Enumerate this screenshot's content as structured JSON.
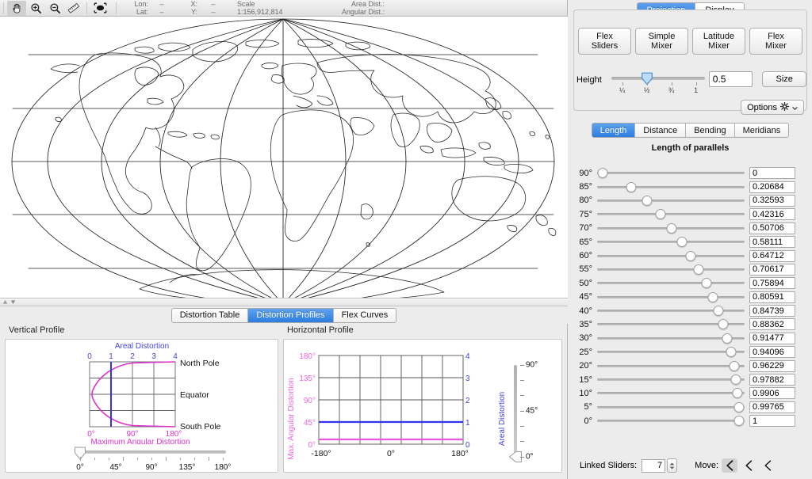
{
  "toolbar": {
    "tools": [
      {
        "name": "pan-tool",
        "icon": "hand-icon",
        "selected": true
      },
      {
        "name": "zoom-in-tool",
        "icon": "magnifier-plus-icon",
        "selected": false
      },
      {
        "name": "zoom-out-tool",
        "icon": "magnifier-minus-icon",
        "selected": false
      },
      {
        "name": "measure-tool",
        "icon": "ruler-icon",
        "selected": false
      },
      {
        "name": "fit-to-window-tool",
        "icon": "fit-bounds-icon",
        "selected": false
      }
    ],
    "status": {
      "lon_label": "Lon:",
      "lon_value": "–",
      "lat_label": "Lat:",
      "lat_value": "–",
      "x_label": "X:",
      "x_value": "–",
      "y_label": "Y:",
      "y_value": "–",
      "scale_label": "Scale",
      "scale_value": "1:156,912,814",
      "area_dist_label": "Area Dist.:",
      "area_dist_value": "",
      "angular_dist_label": "Angular Dist.:",
      "angular_dist_value": ""
    }
  },
  "bottom_tabs": {
    "items": [
      "Distortion Table",
      "Distortion Profiles",
      "Flex Curves"
    ],
    "selected_index": 1
  },
  "vertical_profile": {
    "title": "Vertical Profile",
    "slider": {
      "value_deg": 0,
      "tick_labels": [
        "0°",
        "45°",
        "90°",
        "135°",
        "180°"
      ]
    }
  },
  "horizontal_profile": {
    "title": "Horizontal Profile",
    "slider": {
      "value_deg": 0,
      "tick_labels": [
        "90°",
        "45°",
        "0°"
      ]
    }
  },
  "right_panel": {
    "top_tabs": {
      "items": [
        "Projection",
        "Display"
      ],
      "selected_index": 0
    },
    "mixer_buttons": [
      {
        "line1": "Flex",
        "line2": "Sliders"
      },
      {
        "line1": "Simple",
        "line2": "Mixer"
      },
      {
        "line1": "Latitude",
        "line2": "Mixer"
      },
      {
        "line1": "Flex",
        "line2": "Mixer"
      }
    ],
    "height": {
      "label": "Height",
      "value": "0.5",
      "fraction": 0.5,
      "ticks": [
        {
          "label": "¼",
          "pos": 0.25
        },
        {
          "label": "½",
          "pos": 0.5
        },
        {
          "label": "¾",
          "pos": 0.75
        },
        {
          "label": "1",
          "pos": 1.0
        }
      ]
    },
    "size_button": "Size",
    "options_button": "Options",
    "dist_tabs": {
      "items": [
        "Length",
        "Distance",
        "Bending",
        "Meridians"
      ],
      "selected_index": 0
    },
    "sliders_title": "Length of parallels",
    "parallels": [
      {
        "deg": "90°",
        "value": "0",
        "frac": 0.0
      },
      {
        "deg": "85°",
        "value": "0.20684",
        "frac": 0.20684
      },
      {
        "deg": "80°",
        "value": "0.32593",
        "frac": 0.32593
      },
      {
        "deg": "75°",
        "value": "0.42316",
        "frac": 0.42316
      },
      {
        "deg": "70°",
        "value": "0.50706",
        "frac": 0.50706
      },
      {
        "deg": "65°",
        "value": "0.58111",
        "frac": 0.58111
      },
      {
        "deg": "60°",
        "value": "0.64712",
        "frac": 0.64712
      },
      {
        "deg": "55°",
        "value": "0.70617",
        "frac": 0.70617
      },
      {
        "deg": "50°",
        "value": "0.75894",
        "frac": 0.75894
      },
      {
        "deg": "45°",
        "value": "0.80591",
        "frac": 0.80591
      },
      {
        "deg": "40°",
        "value": "0.84739",
        "frac": 0.84739
      },
      {
        "deg": "35°",
        "value": "0.88362",
        "frac": 0.88362
      },
      {
        "deg": "30°",
        "value": "0.91477",
        "frac": 0.91477
      },
      {
        "deg": "25°",
        "value": "0.94096",
        "frac": 0.94096
      },
      {
        "deg": "20°",
        "value": "0.96229",
        "frac": 0.96229
      },
      {
        "deg": "15°",
        "value": "0.97882",
        "frac": 0.97882
      },
      {
        "deg": "10°",
        "value": "0.9906",
        "frac": 0.9906
      },
      {
        "deg": "5°",
        "value": "0.99765",
        "frac": 0.99765
      },
      {
        "deg": "0°",
        "value": "1",
        "frac": 1.0
      }
    ],
    "bottom": {
      "linked_sliders_label": "Linked Sliders:",
      "linked_sliders_value": "7",
      "move_label": "Move:",
      "move_buttons": [
        "move-left-fast",
        "move-left",
        "move-left-slow"
      ],
      "move_selected_index": 0
    }
  },
  "colors": {
    "accent_blue": "#2b7de0",
    "areal_blue": "#3333ee",
    "angular_magenta": "#dd33cc",
    "panel_gray": "#ececec"
  },
  "chart_data": [
    {
      "type": "line",
      "id": "vertical-profile-chart",
      "title": "",
      "xlabel_top": "Areal Distortion",
      "xlabel_bottom": "Maximum Angular Distortion",
      "ylabel": "",
      "x_top_ticks": [
        "0",
        "1",
        "2",
        "3",
        "4"
      ],
      "x_top_range": [
        0,
        4
      ],
      "x_bottom_ticks": [
        "0°",
        "90°",
        "180°"
      ],
      "x_bottom_range": [
        0,
        180
      ],
      "y_ticks": [
        "North Pole",
        "Equator",
        "South Pole"
      ],
      "y_range": [
        -90,
        90
      ],
      "grid": true,
      "legend": "none",
      "series": [
        {
          "name": "Areal Distortion",
          "color": "#3333ee",
          "axis": "top",
          "points": [
            {
              "lat": 90,
              "value": 1.0
            },
            {
              "lat": 60,
              "value": 1.0
            },
            {
              "lat": 30,
              "value": 1.0
            },
            {
              "lat": 0,
              "value": 1.0
            },
            {
              "lat": -30,
              "value": 1.0
            },
            {
              "lat": -60,
              "value": 1.0
            },
            {
              "lat": -90,
              "value": 1.0
            }
          ]
        },
        {
          "name": "Maximum Angular Distortion",
          "color": "#dd33cc",
          "axis": "bottom",
          "points": [
            {
              "lat": 90,
              "value": 180
            },
            {
              "lat": 80,
              "value": 92
            },
            {
              "lat": 70,
              "value": 56
            },
            {
              "lat": 60,
              "value": 36
            },
            {
              "lat": 45,
              "value": 18
            },
            {
              "lat": 30,
              "value": 9
            },
            {
              "lat": 15,
              "value": 4
            },
            {
              "lat": 0,
              "value": 2
            },
            {
              "lat": -15,
              "value": 4
            },
            {
              "lat": -30,
              "value": 9
            },
            {
              "lat": -45,
              "value": 18
            },
            {
              "lat": -60,
              "value": 36
            },
            {
              "lat": -70,
              "value": 56
            },
            {
              "lat": -80,
              "value": 92
            },
            {
              "lat": -90,
              "value": 180
            }
          ]
        }
      ]
    },
    {
      "type": "line",
      "id": "horizontal-profile-chart",
      "title": "",
      "xlabel": "",
      "ylabel_left": "Max. Angular Distortion",
      "ylabel_right": "Areal Distortion",
      "x_ticks": [
        "-180°",
        "0°",
        "180°"
      ],
      "x_range": [
        -180,
        180
      ],
      "y_left_ticks": [
        "0°",
        "45°",
        "90°",
        "135°",
        "180°"
      ],
      "y_left_range": [
        0,
        180
      ],
      "y_right_ticks": [
        "0",
        "1",
        "2",
        "3",
        "4"
      ],
      "y_right_range": [
        0,
        4
      ],
      "grid": true,
      "legend": "none",
      "series": [
        {
          "name": "Areal Distortion",
          "color": "#3333ee",
          "axis": "right",
          "x": [
            -180,
            -90,
            0,
            90,
            180
          ],
          "values": [
            1,
            1,
            1,
            1,
            1
          ]
        },
        {
          "name": "Max. Angular Distortion",
          "color": "#dd55cc",
          "axis": "left",
          "x": [
            -180,
            -90,
            0,
            90,
            180
          ],
          "values": [
            10,
            10,
            10,
            10,
            10
          ]
        }
      ]
    }
  ]
}
